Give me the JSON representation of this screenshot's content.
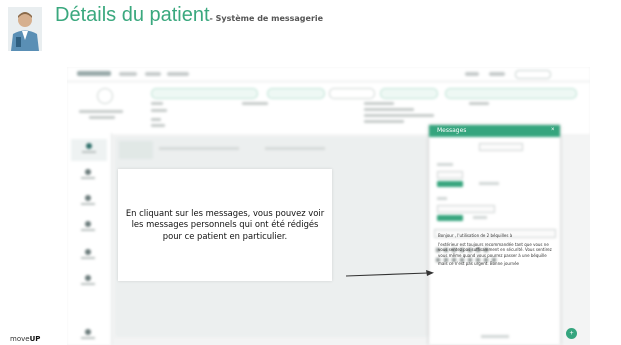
{
  "slide": {
    "title": "Détails du patient",
    "subtitle": "- Système de messagerie",
    "brand": {
      "prefix": "move",
      "suffix": "UP"
    }
  },
  "callout": {
    "text": "En cliquant sur les messages, vous pouvez voir les messages personnels qui ont été rédigés pour ce patient en particulier."
  },
  "messages_panel": {
    "title": "Messages",
    "close": "×",
    "message_lines": [
      "Bonjour , l'utilisation de 2 béquilles à",
      "l'extérieur est toujours recommandée tant que vous ne vous sentez pas suffisamment en sécurité. Vous sentirez vous même quand vous pourrez passer à une béquille",
      "mais ce n'est pas urgent. Bonne journée"
    ],
    "fab": "+"
  },
  "colors": {
    "accent": "#35a57e",
    "title": "#3aa87e"
  }
}
